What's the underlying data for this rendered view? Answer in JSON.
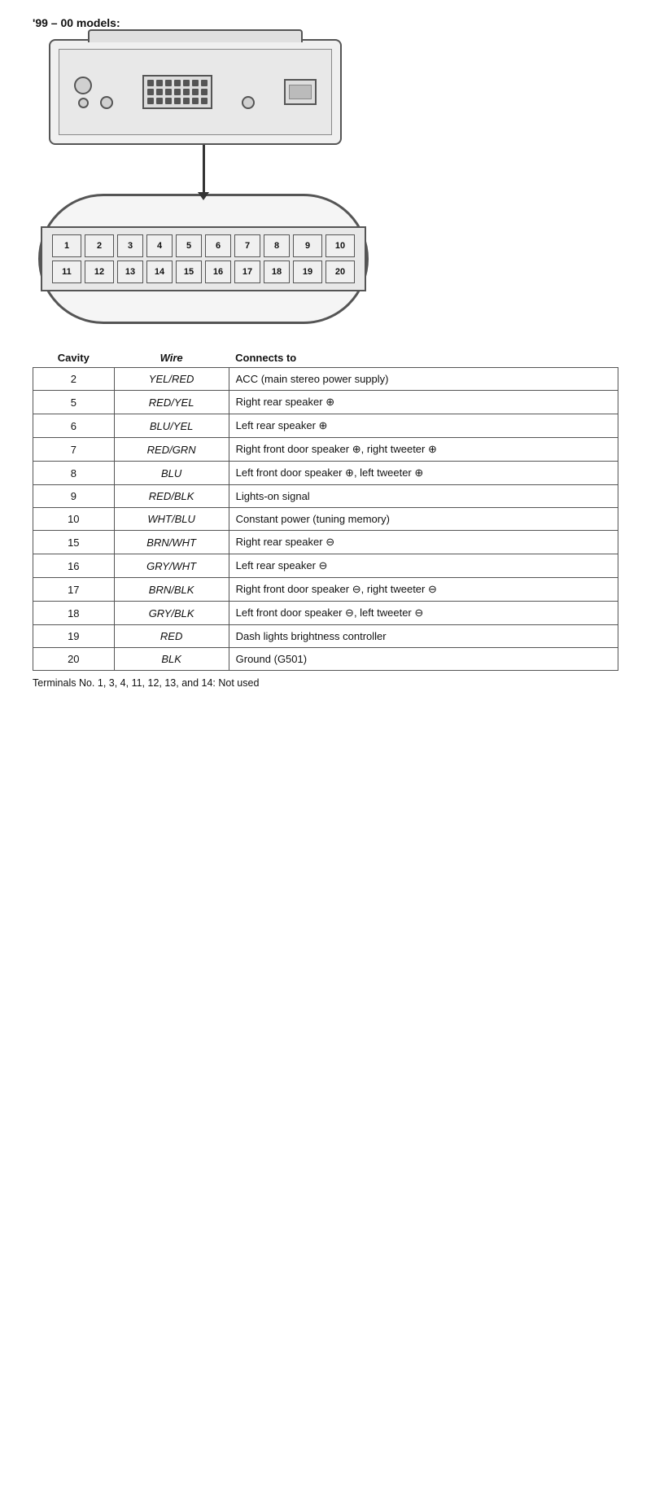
{
  "title": "'99 – 00 models:",
  "diagram": {
    "pin_grid": {
      "row1": [
        "1",
        "2",
        "3",
        "4",
        "5",
        "6",
        "7",
        "8",
        "9",
        "10"
      ],
      "row2": [
        "11",
        "12",
        "13",
        "14",
        "15",
        "16",
        "17",
        "18",
        "19",
        "20"
      ]
    }
  },
  "table": {
    "headers": [
      "Cavity",
      "Wire",
      "Connects to"
    ],
    "rows": [
      {
        "cavity": "2",
        "wire": "YEL/RED",
        "connects": "ACC (main stereo power supply)"
      },
      {
        "cavity": "5",
        "wire": "RED/YEL",
        "connects": "Right rear speaker ⊕"
      },
      {
        "cavity": "6",
        "wire": "BLU/YEL",
        "connects": "Left rear speaker ⊕"
      },
      {
        "cavity": "7",
        "wire": "RED/GRN",
        "connects": "Right front door speaker ⊕, right tweeter ⊕"
      },
      {
        "cavity": "8",
        "wire": "BLU",
        "connects": "Left front door speaker ⊕, left tweeter ⊕"
      },
      {
        "cavity": "9",
        "wire": "RED/BLK",
        "connects": "Lights-on signal"
      },
      {
        "cavity": "10",
        "wire": "WHT/BLU",
        "connects": "Constant power (tuning memory)"
      },
      {
        "cavity": "15",
        "wire": "BRN/WHT",
        "connects": "Right rear speaker ⊖"
      },
      {
        "cavity": "16",
        "wire": "GRY/WHT",
        "connects": "Left rear speaker ⊖"
      },
      {
        "cavity": "17",
        "wire": "BRN/BLK",
        "connects": "Right front door speaker ⊖, right tweeter ⊖"
      },
      {
        "cavity": "18",
        "wire": "GRY/BLK",
        "connects": "Left front door speaker ⊖, left tweeter ⊖"
      },
      {
        "cavity": "19",
        "wire": "RED",
        "connects": "Dash lights brightness controller"
      },
      {
        "cavity": "20",
        "wire": "BLK",
        "connects": "Ground (G501)"
      }
    ]
  },
  "footnote": "Terminals No. 1, 3, 4, 11, 12, 13, and 14: Not used"
}
